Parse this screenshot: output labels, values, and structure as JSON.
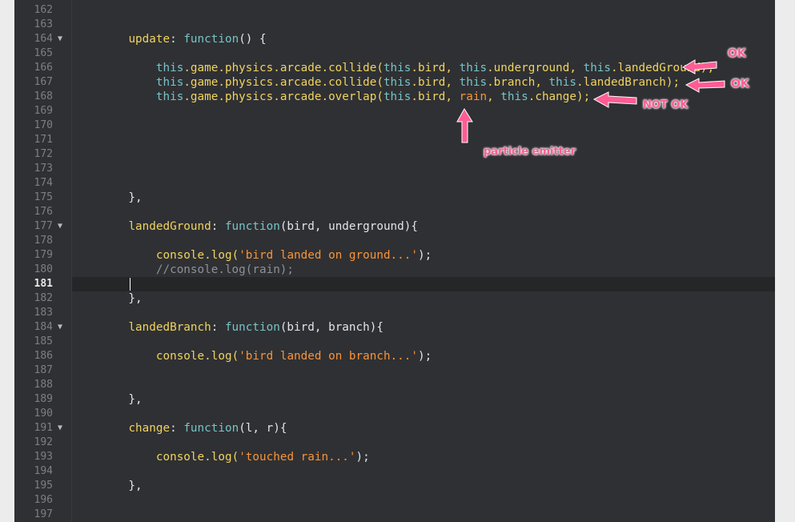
{
  "editor": {
    "lines": [
      {
        "n": "162",
        "fold": false,
        "tokens": []
      },
      {
        "n": "163",
        "fold": false,
        "tokens": []
      },
      {
        "n": "164",
        "fold": true,
        "tokens": [
          {
            "t": "    ",
            "c": "t-def"
          },
          {
            "t": "update",
            "c": "t-key"
          },
          {
            "t": ": ",
            "c": "t-def"
          },
          {
            "t": "function",
            "c": "t-kw"
          },
          {
            "t": "() {",
            "c": "t-def"
          }
        ]
      },
      {
        "n": "165",
        "fold": false,
        "tokens": []
      },
      {
        "n": "166",
        "fold": false,
        "tokens": [
          {
            "t": "        ",
            "c": "t-def"
          },
          {
            "t": "this",
            "c": "t-this"
          },
          {
            "t": ".game.physics.arcade.collide(",
            "c": "t-prop"
          },
          {
            "t": "this",
            "c": "t-this"
          },
          {
            "t": ".bird, ",
            "c": "t-prop"
          },
          {
            "t": "this",
            "c": "t-this"
          },
          {
            "t": ".underground, ",
            "c": "t-prop"
          },
          {
            "t": "this",
            "c": "t-this"
          },
          {
            "t": ".landedGround);",
            "c": "t-prop"
          }
        ]
      },
      {
        "n": "167",
        "fold": false,
        "tokens": [
          {
            "t": "        ",
            "c": "t-def"
          },
          {
            "t": "this",
            "c": "t-this"
          },
          {
            "t": ".game.physics.arcade.collide(",
            "c": "t-prop"
          },
          {
            "t": "this",
            "c": "t-this"
          },
          {
            "t": ".bird, ",
            "c": "t-prop"
          },
          {
            "t": "this",
            "c": "t-this"
          },
          {
            "t": ".branch, ",
            "c": "t-prop"
          },
          {
            "t": "this",
            "c": "t-this"
          },
          {
            "t": ".landedBranch);",
            "c": "t-prop"
          }
        ]
      },
      {
        "n": "168",
        "fold": false,
        "tokens": [
          {
            "t": "        ",
            "c": "t-def"
          },
          {
            "t": "this",
            "c": "t-this"
          },
          {
            "t": ".game.physics.arcade.overlap(",
            "c": "t-prop"
          },
          {
            "t": "this",
            "c": "t-this"
          },
          {
            "t": ".bird, ",
            "c": "t-prop"
          },
          {
            "t": "rain",
            "c": "t-rain"
          },
          {
            "t": ", ",
            "c": "t-prop"
          },
          {
            "t": "this",
            "c": "t-this"
          },
          {
            "t": ".change);",
            "c": "t-prop"
          }
        ]
      },
      {
        "n": "169",
        "fold": false,
        "tokens": []
      },
      {
        "n": "170",
        "fold": false,
        "tokens": []
      },
      {
        "n": "171",
        "fold": false,
        "tokens": []
      },
      {
        "n": "172",
        "fold": false,
        "tokens": []
      },
      {
        "n": "173",
        "fold": false,
        "tokens": []
      },
      {
        "n": "174",
        "fold": false,
        "tokens": []
      },
      {
        "n": "175",
        "fold": false,
        "tokens": [
          {
            "t": "    },",
            "c": "t-def"
          }
        ]
      },
      {
        "n": "176",
        "fold": false,
        "tokens": []
      },
      {
        "n": "177",
        "fold": true,
        "tokens": [
          {
            "t": "    ",
            "c": "t-def"
          },
          {
            "t": "landedGround",
            "c": "t-key"
          },
          {
            "t": ": ",
            "c": "t-def"
          },
          {
            "t": "function",
            "c": "t-kw"
          },
          {
            "t": "(bird, underground){",
            "c": "t-def"
          }
        ]
      },
      {
        "n": "178",
        "fold": false,
        "tokens": []
      },
      {
        "n": "179",
        "fold": false,
        "tokens": [
          {
            "t": "        ",
            "c": "t-def"
          },
          {
            "t": "console",
            "c": "t-key"
          },
          {
            "t": ".log(",
            "c": "t-prop"
          },
          {
            "t": "'bird landed on ground...'",
            "c": "t-str"
          },
          {
            "t": ");",
            "c": "t-def"
          }
        ]
      },
      {
        "n": "180",
        "fold": false,
        "tokens": [
          {
            "t": "        ",
            "c": "t-def"
          },
          {
            "t": "//console.log(rain);",
            "c": "t-cmt"
          }
        ]
      },
      {
        "n": "181",
        "fold": false,
        "active": true,
        "tokens": []
      },
      {
        "n": "182",
        "fold": false,
        "tokens": [
          {
            "t": "    },",
            "c": "t-def"
          }
        ]
      },
      {
        "n": "183",
        "fold": false,
        "tokens": []
      },
      {
        "n": "184",
        "fold": true,
        "tokens": [
          {
            "t": "    ",
            "c": "t-def"
          },
          {
            "t": "landedBranch",
            "c": "t-key"
          },
          {
            "t": ": ",
            "c": "t-def"
          },
          {
            "t": "function",
            "c": "t-kw"
          },
          {
            "t": "(bird, branch){",
            "c": "t-def"
          }
        ]
      },
      {
        "n": "185",
        "fold": false,
        "tokens": []
      },
      {
        "n": "186",
        "fold": false,
        "tokens": [
          {
            "t": "        ",
            "c": "t-def"
          },
          {
            "t": "console",
            "c": "t-key"
          },
          {
            "t": ".log(",
            "c": "t-prop"
          },
          {
            "t": "'bird landed on branch...'",
            "c": "t-str"
          },
          {
            "t": ");",
            "c": "t-def"
          }
        ]
      },
      {
        "n": "187",
        "fold": false,
        "tokens": []
      },
      {
        "n": "188",
        "fold": false,
        "tokens": []
      },
      {
        "n": "189",
        "fold": false,
        "tokens": [
          {
            "t": "    },",
            "c": "t-def"
          }
        ]
      },
      {
        "n": "190",
        "fold": false,
        "tokens": []
      },
      {
        "n": "191",
        "fold": true,
        "tokens": [
          {
            "t": "    ",
            "c": "t-def"
          },
          {
            "t": "change",
            "c": "t-key"
          },
          {
            "t": ": ",
            "c": "t-def"
          },
          {
            "t": "function",
            "c": "t-kw"
          },
          {
            "t": "(l, r){",
            "c": "t-def"
          }
        ]
      },
      {
        "n": "192",
        "fold": false,
        "tokens": []
      },
      {
        "n": "193",
        "fold": false,
        "tokens": [
          {
            "t": "        ",
            "c": "t-def"
          },
          {
            "t": "console",
            "c": "t-key"
          },
          {
            "t": ".log(",
            "c": "t-prop"
          },
          {
            "t": "'touched rain...'",
            "c": "t-str"
          },
          {
            "t": ");",
            "c": "t-def"
          }
        ]
      },
      {
        "n": "194",
        "fold": false,
        "tokens": []
      },
      {
        "n": "195",
        "fold": false,
        "tokens": [
          {
            "t": "    },",
            "c": "t-def"
          }
        ]
      },
      {
        "n": "196",
        "fold": false,
        "tokens": []
      },
      {
        "n": "197",
        "fold": false,
        "tokens": []
      }
    ],
    "fold_glyph": "▼"
  },
  "annotations": {
    "ok_1": "OK",
    "ok_2": "OK",
    "not_ok": "NOT OK",
    "particle": "particle emitter",
    "color": "#ff5c93"
  }
}
